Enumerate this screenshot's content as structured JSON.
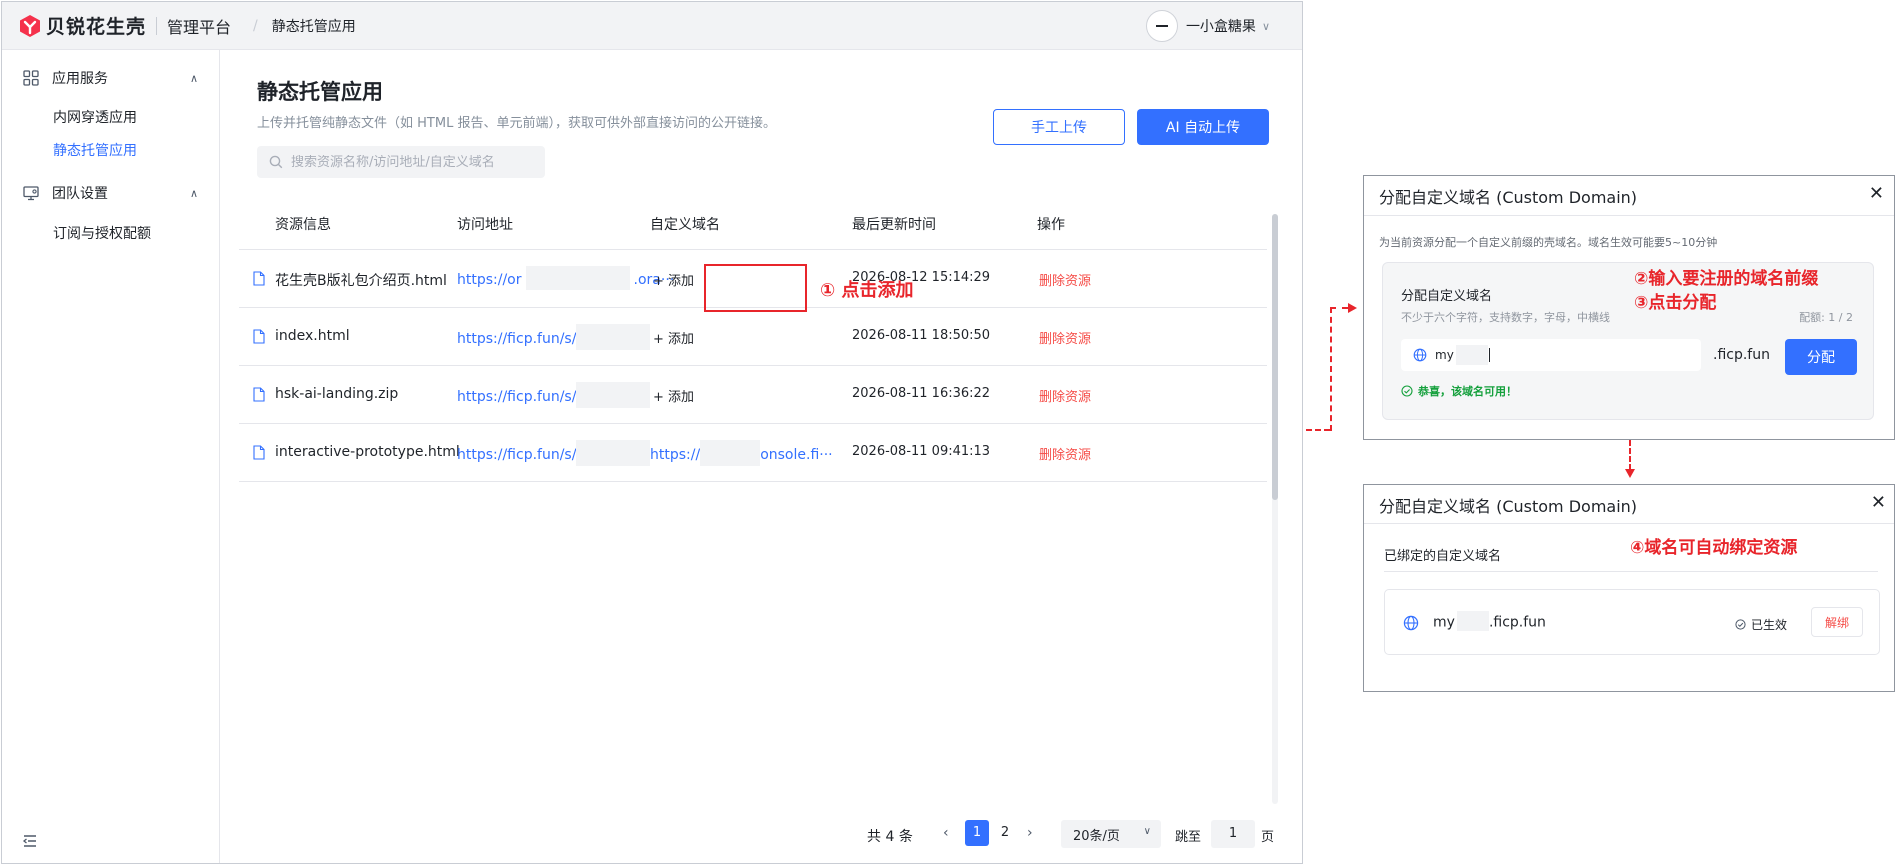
{
  "header": {
    "brand": "贝锐花生壳",
    "platform": "管理平台",
    "breadcrumb": "静态托管应用",
    "user_name": "一小盒糖果"
  },
  "sidebar": {
    "groups": [
      {
        "label": "应用服务",
        "icon": "grid-icon",
        "items": [
          "内网穿透应用",
          "静态托管应用"
        ]
      },
      {
        "label": "团队设置",
        "icon": "monitor-icon",
        "items": [
          "订阅与授权配额"
        ]
      }
    ],
    "active_item": "静态托管应用"
  },
  "main": {
    "title": "静态托管应用",
    "subtitle": "上传并托管纯静态文件（如 HTML 报告、单元前端），获取可供外部直接访问的公开链接。",
    "search_placeholder": "搜索资源名称/访问地址/自定义域名",
    "manual_upload": "手工上传",
    "ai_upload": "AI 自动上传",
    "columns": [
      "资源信息",
      "访问地址",
      "自定义域名",
      "最后更新时间",
      "操作"
    ],
    "rows": [
      {
        "name": "花生壳B版礼包介绍页.html",
        "url_prefix": "https://or",
        "url_suffix": ".ora···",
        "domain": "+ 添加",
        "updated": "2026-08-12 15:14:29",
        "action": "删除资源"
      },
      {
        "name": "index.html",
        "url_prefix": "https://ficp.fun/s/",
        "url_suffix": "",
        "domain": "+ 添加",
        "updated": "2026-08-11 18:50:50",
        "action": "删除资源"
      },
      {
        "name": "hsk-ai-landing.zip",
        "url_prefix": "https://ficp.fun/s/",
        "url_suffix": "",
        "domain": "+ 添加",
        "updated": "2026-08-11 16:36:22",
        "action": "删除资源"
      },
      {
        "name": "interactive-prototype.html",
        "url_prefix": "https://ficp.fun/s/",
        "url_suffix": "",
        "domain_prefix": "https://",
        "domain_suffix": "onsole.fi···",
        "updated": "2026-08-11 09:41:13",
        "action": "删除资源"
      }
    ],
    "pagination": {
      "total_prefix": "共",
      "total": "4",
      "total_suffix": "条",
      "pages": [
        "1",
        "2"
      ],
      "current": "1",
      "page_size": "20条/页",
      "jump_label": "跳至",
      "jump_value": "1",
      "page_label": "页"
    }
  },
  "annotations": {
    "step1": "① 点击添加",
    "step2": "②输入要注册的域名前缀",
    "step3": "③点击分配",
    "step4": "④域名可自动绑定资源"
  },
  "dialog_assign": {
    "title": "分配自定义域名 (Custom Domain)",
    "hint": "为当前资源分配一个自定义前缀的壳域名。域名生效可能要5~10分钟",
    "card_title": "分配自定义域名",
    "card_desc": "不少于六个字符，支持数字，字母，中横线",
    "quota": "配额: 1 / 2",
    "input_value": "my",
    "suffix": ".ficp.fun",
    "assign_button": "分配",
    "success": "恭喜，该域名可用！"
  },
  "dialog_bound": {
    "title": "分配自定义域名 (Custom Domain)",
    "bound_label": "已绑定的自定义域名",
    "domain_prefix": "my",
    "domain_suffix": ".ficp.fun",
    "status": "已生效",
    "unbind_button": "解绑"
  },
  "colors": {
    "primary": "#3370ff",
    "danger": "#f54a45",
    "annotation": "#e8252b",
    "success": "#14a03c",
    "logo": "#f5324c"
  }
}
